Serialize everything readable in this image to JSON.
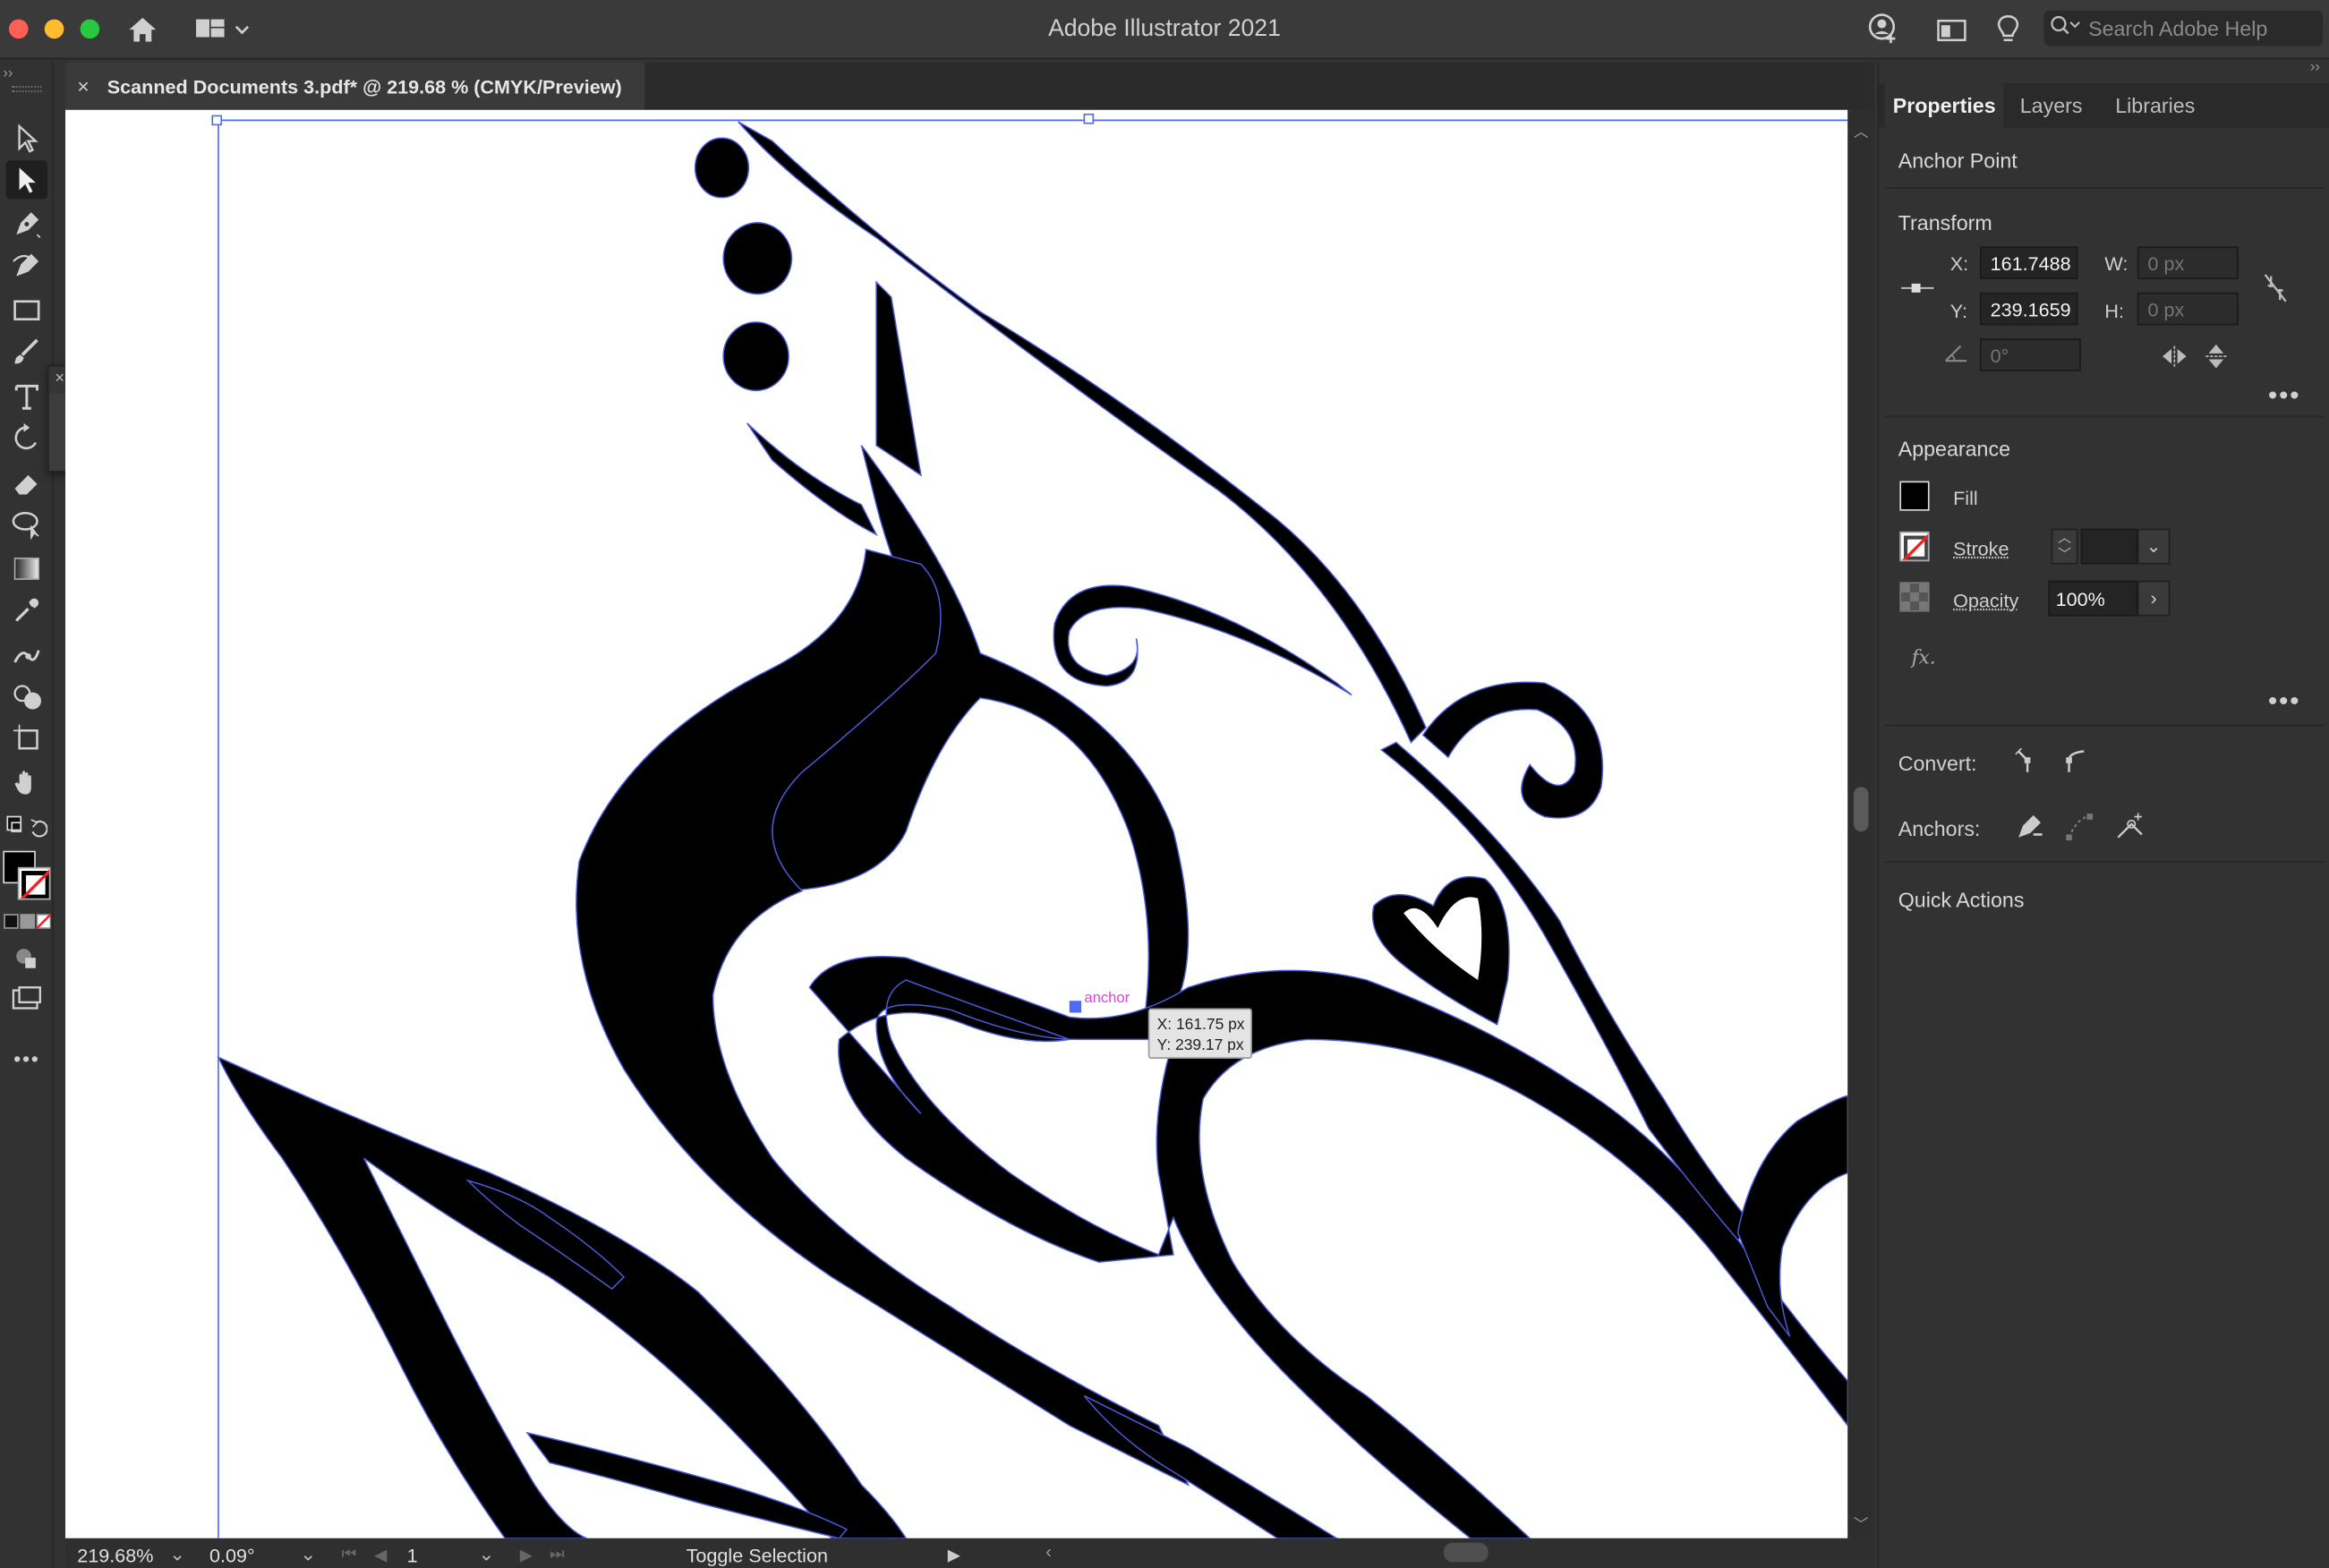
{
  "window": {
    "app_title": "Adobe Illustrator 2021"
  },
  "titlebar": {
    "search_placeholder": "Search Adobe Help",
    "icons": [
      "home-icon",
      "workspace-switcher-icon",
      "user-icon",
      "panel-icon",
      "lightbulb-icon",
      "search-icon"
    ]
  },
  "document_tab": {
    "title": "Scanned Documents 3.pdf* @ 219.68 % (CMYK/Preview)",
    "close": "×"
  },
  "tools": [
    "selection-tool",
    "direct-selection-tool",
    "pen-tool",
    "curvature-tool",
    "rectangle-tool",
    "paintbrush-tool",
    "type-tool",
    "rotate-tool",
    "eraser-tool",
    "lasso-tool",
    "gradient-tool",
    "eyedropper-tool",
    "puppet-warp-tool",
    "shape-builder-tool",
    "artboard-tool",
    "hand-tool"
  ],
  "float_panel": {
    "close": "×",
    "collapse": "‹‹",
    "tools": [
      "paintbrush-tool",
      "blob-brush-tool",
      "pencil-tool"
    ]
  },
  "canvas": {
    "anchor_label": "anchor",
    "tooltip_x": "X: 161.75 px",
    "tooltip_y": "Y: 239.17 px",
    "accent_color": "#4a6cf7"
  },
  "status_bar": {
    "zoom": "219.68%",
    "rotation": "0.09°",
    "artboard": "1",
    "mode": "Toggle Selection"
  },
  "properties": {
    "tabs": [
      "Properties",
      "Layers",
      "Libraries"
    ],
    "active_tab": "Properties",
    "selection_type": "Anchor Point",
    "transform": {
      "title": "Transform",
      "x_label": "X:",
      "x_value": "161.7488",
      "y_label": "Y:",
      "y_value": "239.1659",
      "w_label": "W:",
      "w_placeholder": "0 px",
      "h_label": "H:",
      "h_placeholder": "0 px",
      "angle_placeholder": "0°"
    },
    "appearance": {
      "title": "Appearance",
      "fill_label": "Fill",
      "stroke_label": "Stroke",
      "opacity_label": "Opacity",
      "opacity_value": "100%",
      "fx_label": "fx."
    },
    "convert_label": "Convert:",
    "anchors_label": "Anchors:",
    "quick_actions_label": "Quick Actions"
  }
}
